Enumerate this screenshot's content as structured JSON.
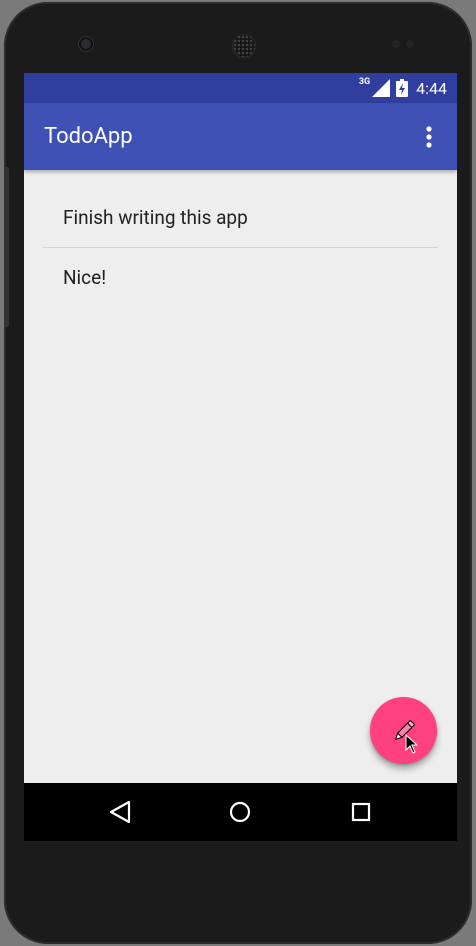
{
  "status_bar": {
    "network_label": "3G",
    "time": "4:44",
    "icons": [
      "signal-icon",
      "battery-charging-icon"
    ]
  },
  "app_bar": {
    "title": "TodoApp",
    "menu_icon": "more-vert-icon"
  },
  "todo_list": {
    "items": [
      {
        "text": "Finish writing this app"
      },
      {
        "text": "Nice!"
      }
    ]
  },
  "fab": {
    "icon": "pencil-icon",
    "color": "#ff4081"
  },
  "nav_bar": {
    "buttons": [
      "back-icon",
      "home-icon",
      "recents-icon"
    ]
  },
  "colors": {
    "primary": "#3f51b5",
    "primary_dark": "#303f9f",
    "accent": "#ff4081",
    "background": "#eeeeee"
  }
}
